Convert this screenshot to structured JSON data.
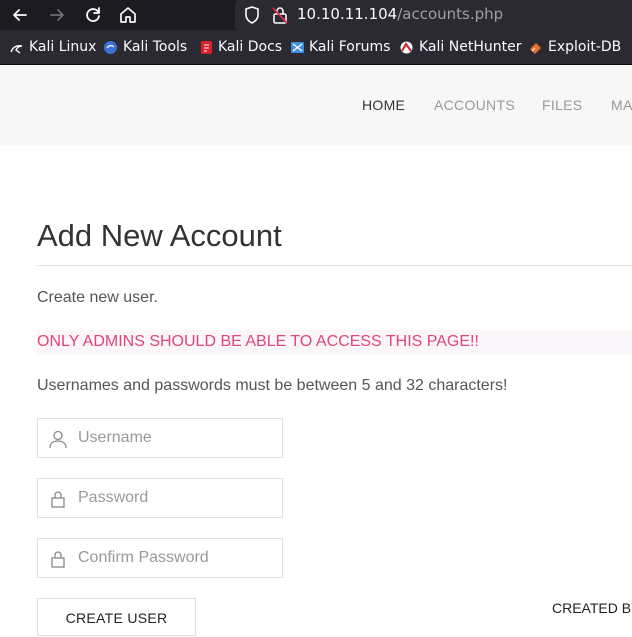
{
  "browser": {
    "url_host": "10.10.11.104",
    "url_path": "/accounts.php"
  },
  "bookmarks": [
    {
      "label": "Kali Linux",
      "icon": "kali-linux-icon"
    },
    {
      "label": "Kali Tools",
      "icon": "kali-tools-icon"
    },
    {
      "label": "Kali Docs",
      "icon": "kali-docs-icon"
    },
    {
      "label": "Kali Forums",
      "icon": "kali-forums-icon"
    },
    {
      "label": "Kali NetHunter",
      "icon": "kali-nethunter-icon"
    },
    {
      "label": "Exploit-DB",
      "icon": "exploit-db-icon"
    }
  ],
  "nav": {
    "home": "HOME",
    "accounts": "ACCOUNTS",
    "files": "FILES",
    "more": "MA"
  },
  "page": {
    "title": "Add New Account",
    "intro": "Create new user.",
    "warning": "ONLY ADMINS SHOULD BE ABLE TO ACCESS THIS PAGE!!",
    "rule": "Usernames and passwords must be between 5 and 32 characters!"
  },
  "form": {
    "username_placeholder": "Username",
    "password_placeholder": "Password",
    "confirm_placeholder": "Confirm Password",
    "submit_label": "CREATE USER"
  },
  "footer": {
    "created_by": "CREATED BY"
  },
  "colors": {
    "warning_text": "#e0457b",
    "warning_bg": "#fbf6f9",
    "toolbar_bg": "#1c1b22"
  }
}
